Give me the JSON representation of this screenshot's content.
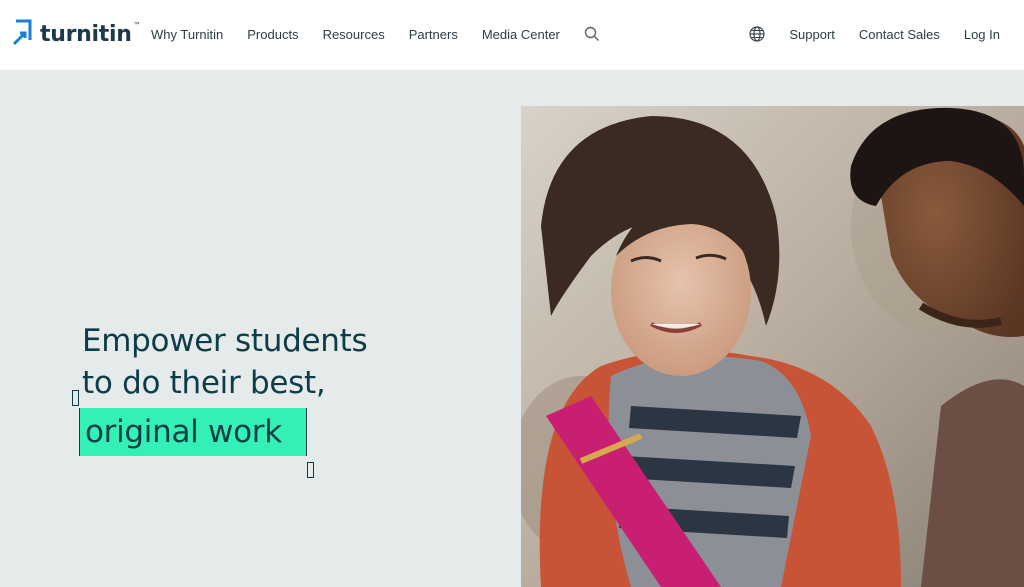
{
  "header": {
    "logo_text": "turnitin",
    "logo_tm": "™",
    "nav_left": [
      "Why Turnitin",
      "Products",
      "Resources",
      "Partners",
      "Media Center"
    ],
    "nav_right": [
      "Support",
      "Contact Sales",
      "Log In"
    ]
  },
  "hero": {
    "line1": "Empower students",
    "line2": "to do their best,",
    "highlight": "original work"
  },
  "colors": {
    "brand_navy": "#1b3a4b",
    "accent_green": "#33f1b6",
    "hero_text": "#0f3d47",
    "page_bg": "#e5eaeb"
  },
  "icons": {
    "search": "search-icon",
    "globe": "globe-icon",
    "logo": "turnitin-logo-icon"
  }
}
